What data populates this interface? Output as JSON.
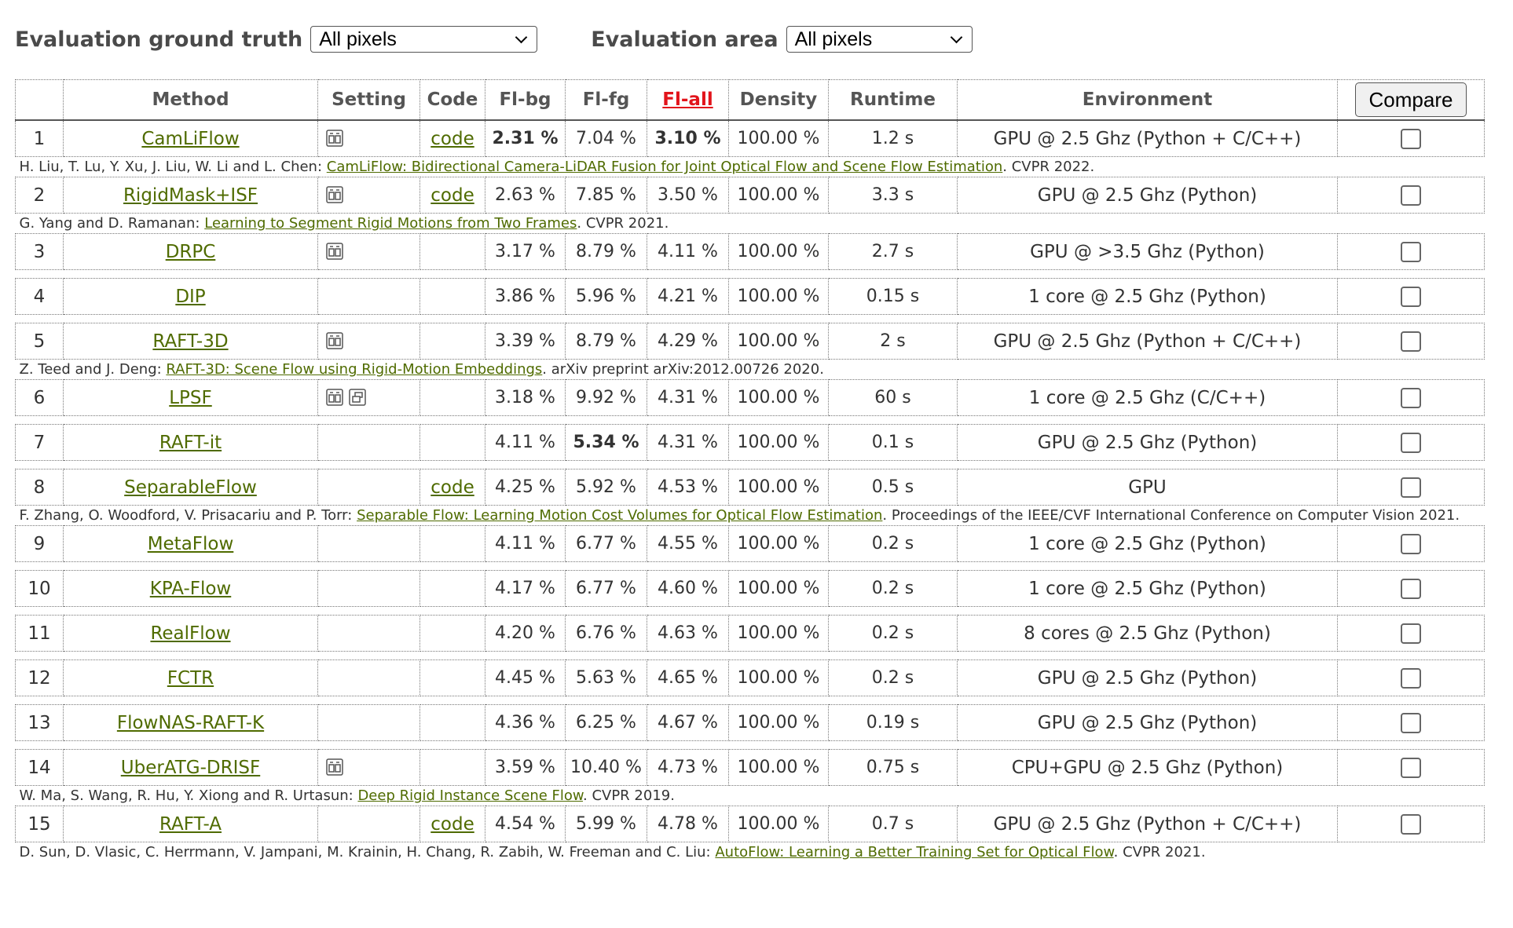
{
  "filters": {
    "ground_truth_label": "Evaluation ground truth",
    "ground_truth_value": "All pixels",
    "area_label": "Evaluation area",
    "area_value": "All pixels"
  },
  "table": {
    "headers": [
      "",
      "Method",
      "Setting",
      "Code",
      "Fl-bg",
      "Fl-fg",
      "Fl-all",
      "Density",
      "Runtime",
      "Environment"
    ],
    "compare_label": "Compare",
    "rows": [
      {
        "rank": "1",
        "method": "CamLiFlow",
        "icons": [
          "stereo-icon"
        ],
        "code": "code",
        "fl_bg": "2.31 %",
        "fl_fg": "7.04 %",
        "fl_all": "3.10 %",
        "density": "100.00 %",
        "runtime": "1.2 s",
        "env": "GPU @ 2.5 Ghz (Python + C/C++)",
        "ref": {
          "authors": "H. Liu, T. Lu, Y. Xu, J. Liu, W. Li and L. Chen: ",
          "title": "CamLiFlow: Bidirectional Camera-LiDAR Fusion for Joint Optical Flow and Scene Flow Estimation",
          "venue": ". CVPR 2022."
        }
      },
      {
        "rank": "2",
        "method": "RigidMask+ISF",
        "icons": [
          "stereo-icon"
        ],
        "code": "code",
        "fl_bg": "2.63 %",
        "fl_fg": "7.85 %",
        "fl_all": "3.50 %",
        "density": "100.00 %",
        "runtime": "3.3 s",
        "env": "GPU @ 2.5 Ghz (Python)",
        "ref": {
          "authors": "G. Yang and D. Ramanan: ",
          "title": "Learning to Segment Rigid Motions from Two Frames",
          "venue": ". CVPR 2021."
        }
      },
      {
        "rank": "3",
        "method": "DRPC",
        "icons": [
          "stereo-icon"
        ],
        "code": "",
        "fl_bg": "3.17 %",
        "fl_fg": "8.79 %",
        "fl_all": "4.11 %",
        "density": "100.00 %",
        "runtime": "2.7 s",
        "env": "GPU @ >3.5 Ghz (Python)",
        "ref": null
      },
      {
        "rank": "4",
        "method": "DIP",
        "icons": [],
        "code": "",
        "fl_bg": "3.86 %",
        "fl_fg": "5.96 %",
        "fl_all": "4.21 %",
        "density": "100.00 %",
        "runtime": "0.15 s",
        "env": "1 core @ 2.5 Ghz (Python)",
        "ref": null
      },
      {
        "rank": "5",
        "method": "RAFT-3D",
        "icons": [
          "stereo-icon"
        ],
        "code": "",
        "fl_bg": "3.39 %",
        "fl_fg": "8.79 %",
        "fl_all": "4.29 %",
        "density": "100.00 %",
        "runtime": "2 s",
        "env": "GPU @ 2.5 Ghz (Python + C/C++)",
        "ref": {
          "authors": "Z. Teed and J. Deng: ",
          "title": "RAFT-3D: Scene Flow using Rigid-Motion Embeddings",
          "venue": ". arXiv preprint arXiv:2012.00726 2020."
        }
      },
      {
        "rank": "6",
        "method": "LPSF",
        "icons": [
          "stereo-icon",
          "multiview-icon"
        ],
        "code": "",
        "fl_bg": "3.18 %",
        "fl_fg": "9.92 %",
        "fl_all": "4.31 %",
        "density": "100.00 %",
        "runtime": "60 s",
        "env": "1 core @ 2.5 Ghz (C/C++)",
        "ref": null
      },
      {
        "rank": "7",
        "method": "RAFT-it",
        "icons": [],
        "code": "",
        "fl_bg": "4.11 %",
        "fl_fg": "5.34 %",
        "fl_all": "4.31 %",
        "density": "100.00 %",
        "runtime": "0.1 s",
        "env": "GPU @ 2.5 Ghz (Python)",
        "ref": null
      },
      {
        "rank": "8",
        "method": "SeparableFlow",
        "icons": [],
        "code": "code",
        "fl_bg": "4.25 %",
        "fl_fg": "5.92 %",
        "fl_all": "4.53 %",
        "density": "100.00 %",
        "runtime": "0.5 s",
        "env": "GPU",
        "ref": {
          "authors": "F. Zhang, O. Woodford, V. Prisacariu and P. Torr: ",
          "title": "Separable Flow: Learning Motion Cost Volumes for Optical Flow Estimation",
          "venue": ". Proceedings of the IEEE/CVF International Conference on Computer Vision 2021."
        }
      },
      {
        "rank": "9",
        "method": "MetaFlow",
        "icons": [],
        "code": "",
        "fl_bg": "4.11 %",
        "fl_fg": "6.77 %",
        "fl_all": "4.55 %",
        "density": "100.00 %",
        "runtime": "0.2 s",
        "env": "1 core @ 2.5 Ghz (Python)",
        "ref": null
      },
      {
        "rank": "10",
        "method": "KPA-Flow",
        "icons": [],
        "code": "",
        "fl_bg": "4.17 %",
        "fl_fg": "6.77 %",
        "fl_all": "4.60 %",
        "density": "100.00 %",
        "runtime": "0.2 s",
        "env": "1 core @ 2.5 Ghz (Python)",
        "ref": null
      },
      {
        "rank": "11",
        "method": "RealFlow",
        "icons": [],
        "code": "",
        "fl_bg": "4.20 %",
        "fl_fg": "6.76 %",
        "fl_all": "4.63 %",
        "density": "100.00 %",
        "runtime": "0.2 s",
        "env": "8 cores @ 2.5 Ghz (Python)",
        "ref": null
      },
      {
        "rank": "12",
        "method": "FCTR",
        "icons": [],
        "code": "",
        "fl_bg": "4.45 %",
        "fl_fg": "5.63 %",
        "fl_all": "4.65 %",
        "density": "100.00 %",
        "runtime": "0.2 s",
        "env": "GPU @ 2.5 Ghz (Python)",
        "ref": null
      },
      {
        "rank": "13",
        "method": "FlowNAS-RAFT-K",
        "icons": [],
        "code": "",
        "fl_bg": "4.36 %",
        "fl_fg": "6.25 %",
        "fl_all": "4.67 %",
        "density": "100.00 %",
        "runtime": "0.19 s",
        "env": "GPU @ 2.5 Ghz (Python)",
        "ref": null
      },
      {
        "rank": "14",
        "method": "UberATG-DRISF",
        "icons": [
          "stereo-icon"
        ],
        "code": "",
        "fl_bg": "3.59 %",
        "fl_fg": "10.40 %",
        "fl_all": "4.73 %",
        "density": "100.00 %",
        "runtime": "0.75 s",
        "env": "CPU+GPU @ 2.5 Ghz (Python)",
        "ref": {
          "authors": "W. Ma, S. Wang, R. Hu, Y. Xiong and R. Urtasun: ",
          "title": "Deep Rigid Instance Scene Flow",
          "venue": ". CVPR 2019."
        }
      },
      {
        "rank": "15",
        "method": "RAFT-A",
        "icons": [],
        "code": "code",
        "fl_bg": "4.54 %",
        "fl_fg": "5.99 %",
        "fl_all": "4.78 %",
        "density": "100.00 %",
        "runtime": "0.7 s",
        "env": "GPU @ 2.5 Ghz (Python + C/C++)",
        "ref": {
          "authors": "D. Sun, D. Vlasic, C. Herrmann, V. Jampani, M. Krainin, H. Chang, R. Zabih, W. Freeman and C. Liu: ",
          "title": "AutoFlow: Learning a Better Training Set for Optical Flow",
          "venue": ". CVPR 2021."
        }
      }
    ],
    "bold_cells": [
      {
        "rank": "1",
        "column": "fl_bg"
      },
      {
        "rank": "1",
        "column": "fl_all"
      },
      {
        "rank": "7",
        "column": "fl_fg"
      }
    ]
  },
  "colors": {
    "link": "#4f6b00",
    "sort_header": "#e2141b"
  }
}
